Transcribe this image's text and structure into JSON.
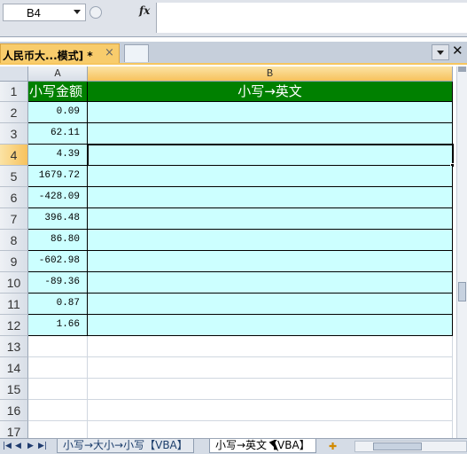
{
  "formula_bar": {
    "name_box": "B4",
    "fx_label": "fx",
    "formula": ""
  },
  "doc_tab": {
    "title": "人民币大...模式] *",
    "close_glyph": "×"
  },
  "tab_close_glyph": "✕",
  "columns": [
    {
      "label": "A",
      "active": false
    },
    {
      "label": "B",
      "active": true
    }
  ],
  "rows": [
    "1",
    "2",
    "3",
    "4",
    "5",
    "6",
    "7",
    "8",
    "9",
    "10",
    "11",
    "12",
    "13",
    "14",
    "15",
    "16",
    "17"
  ],
  "active_row": "4",
  "header": {
    "a": "小写金额",
    "b": "小写→英文"
  },
  "values": [
    "0.09",
    "62.11",
    "4.39",
    "1679.72",
    "-428.09",
    "396.48",
    "86.80",
    "-602.98",
    "-89.36",
    "0.87",
    "1.66"
  ],
  "sheet_tabs": [
    {
      "label": "小写→大小→小写【VBA】",
      "active": false
    },
    {
      "label": "小写→英文【VBA】",
      "active": true
    }
  ],
  "nav_glyphs": [
    "|◀",
    "◀",
    "▶",
    "▶|"
  ],
  "colors": {
    "header_green": "#008000",
    "data_fill": "#ccffff",
    "active_heading": "#f7c25d"
  }
}
